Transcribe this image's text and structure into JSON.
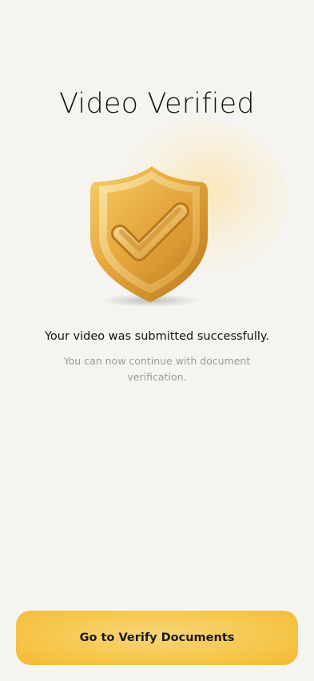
{
  "screen": {
    "title": "Video Verified",
    "headline": "Your video was submitted successfully.",
    "subtext": "You can now continue with document verification.",
    "illustration_icon": "gold-shield-check-icon"
  },
  "actions": {
    "primary_label": "Go to Verify Documents"
  },
  "colors": {
    "background": "#f5f4f0",
    "accent": "#f6c84e",
    "shield_gold": "#e8a93a",
    "muted_text": "#9a9a9a"
  }
}
